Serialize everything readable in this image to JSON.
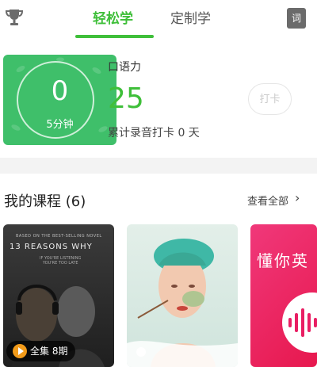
{
  "header": {
    "tabs": [
      {
        "label": "轻松学",
        "active": true
      },
      {
        "label": "定制学",
        "active": false
      }
    ],
    "dict_label": "词",
    "accent": "#3fbf3a"
  },
  "study": {
    "minutes_value": "0",
    "minutes_unit": "5分钟",
    "oral_label": "口语力",
    "oral_value": "25",
    "checkin_stat": "累计录音打卡 0 天",
    "checkin_button": "打卡"
  },
  "courses": {
    "title": "我的课程 (6)",
    "view_all": "查看全部",
    "items": [
      {
        "poster_tagline": "BASED ON THE BEST-SELLING NOVEL",
        "poster_title": "13 REASONS WHY",
        "poster_sub": "IF YOU'RE LISTENING\nYOU'RE TOO LATE",
        "badge": "全集 8期"
      },
      {
        "badge": ""
      },
      {
        "text": "懂你英"
      }
    ]
  }
}
